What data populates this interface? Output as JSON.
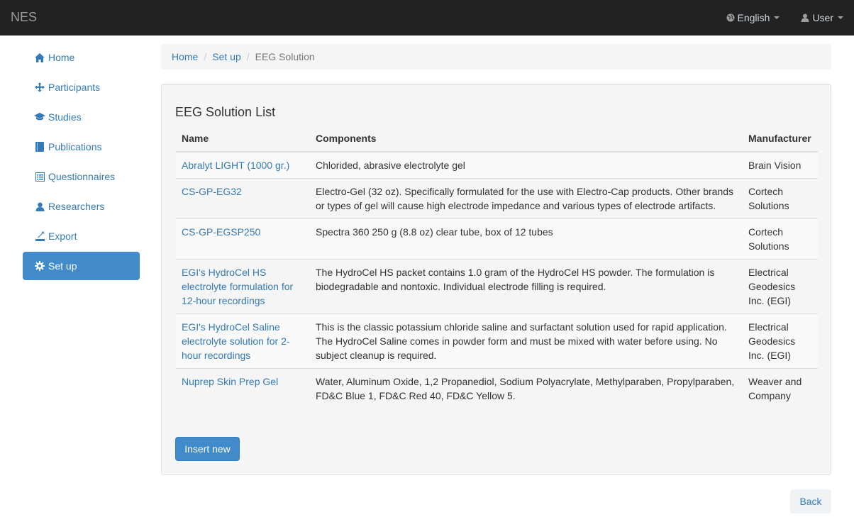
{
  "navbar": {
    "brand": "NES",
    "language": "English",
    "user": "User"
  },
  "sidebar": {
    "items": [
      {
        "label": "Home",
        "icon": "home-icon"
      },
      {
        "label": "Participants",
        "icon": "move-icon"
      },
      {
        "label": "Studies",
        "icon": "education-icon"
      },
      {
        "label": "Publications",
        "icon": "book-icon"
      },
      {
        "label": "Questionnaires",
        "icon": "list-alt-icon"
      },
      {
        "label": "Researchers",
        "icon": "user-icon"
      },
      {
        "label": "Export",
        "icon": "export-icon"
      },
      {
        "label": "Set up",
        "icon": "cog-icon",
        "active": true
      }
    ]
  },
  "breadcrumb": {
    "home": "Home",
    "setup": "Set up",
    "current": "EEG Solution"
  },
  "panel": {
    "title": "EEG Solution List",
    "headers": {
      "name": "Name",
      "components": "Components",
      "manufacturer": "Manufacturer"
    },
    "rows": [
      {
        "name": "Abralyt LIGHT (1000 gr.)",
        "components": "Chlorided, abrasive electrolyte gel",
        "manufacturer": "Brain Vision"
      },
      {
        "name": "CS-GP-EG32",
        "components": "Electro-Gel (32 oz). Specifically formulated for the use with Electro-Cap products. Other brands or types of gel will cause high electrode impedance and various types of electrode artifacts.",
        "manufacturer": "Cortech Solutions"
      },
      {
        "name": "CS-GP-EGSP250",
        "components": "Spectra 360 250 g (8.8 oz) clear tube, box of 12 tubes",
        "manufacturer": "Cortech Solutions"
      },
      {
        "name": "EGI's HydroCel HS electrolyte formulation for 12-hour recordings",
        "components": "The HydroCel HS packet contains 1.0 gram of the HydroCel HS powder. The formulation is biodegradable and nontoxic. Individual electrode filling is required.",
        "manufacturer": "Electrical Geodesics Inc. (EGI)"
      },
      {
        "name": "EGI's HydroCel Saline electrolyte solution for 2-hour recordings",
        "components": "This is the classic potassium chloride saline and surfactant solution used for rapid application. The HydroCel Saline comes in powder form and must be mixed with water before using. No subject cleanup is required.",
        "manufacturer": "Electrical Geodesics Inc. (EGI)"
      },
      {
        "name": "Nuprep Skin Prep Gel",
        "components": "Water, Aluminum Oxide, 1,2 Propanediol, Sodium Polyacrylate, Methylparaben, Propylparaben, FD&C Blue 1, FD&C Red 40, FD&C Yellow 5.",
        "manufacturer": "Weaver and Company"
      }
    ],
    "insert_label": "Insert new"
  },
  "back_label": "Back",
  "colors": {
    "navbar_bg": "#222222",
    "link": "#337ab7",
    "active_bg": "#428bca",
    "panel_bg": "#f5f5f5"
  }
}
